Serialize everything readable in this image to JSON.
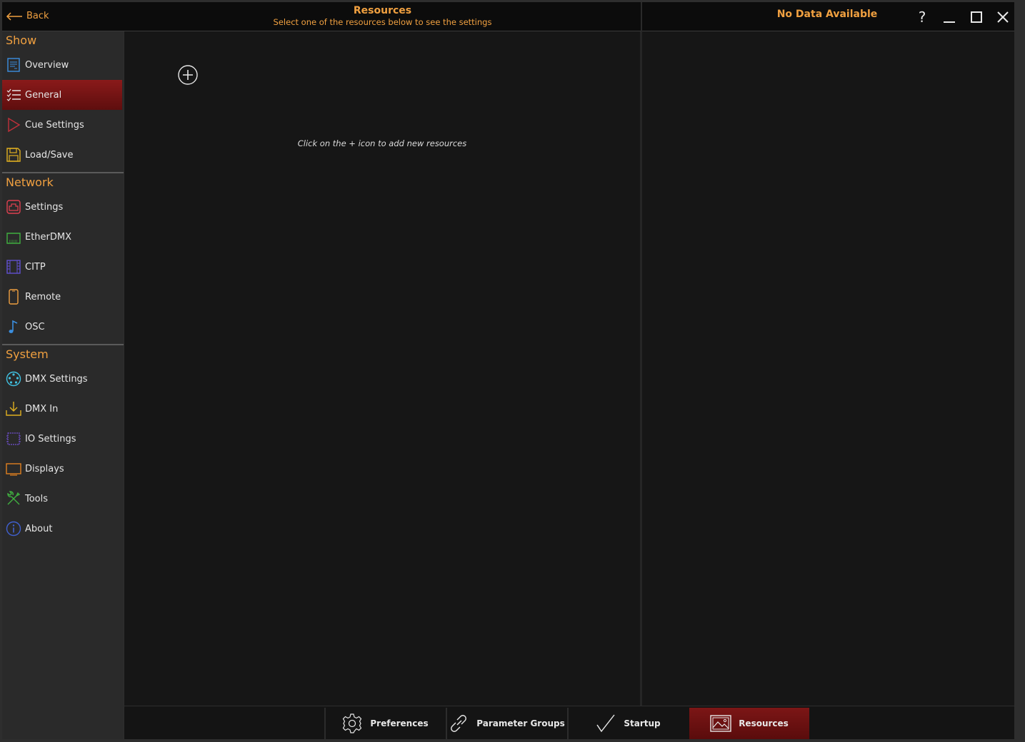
{
  "header": {
    "back_label": "Back",
    "title": "Resources",
    "subtitle": "Select one of the resources below to see the settings",
    "right_title": "No Data Available",
    "help_label": "?"
  },
  "sidebar": {
    "sections": [
      {
        "title": "Show",
        "items": [
          {
            "label": "Overview",
            "icon": "document-icon",
            "color": "#3b8fe0"
          },
          {
            "label": "General",
            "icon": "checklist-icon",
            "color": "#e6e6e6",
            "active": true
          },
          {
            "label": "Cue Settings",
            "icon": "play-icon",
            "color": "#c0303a"
          },
          {
            "label": "Load/Save",
            "icon": "floppy-icon",
            "color": "#e0b020"
          }
        ]
      },
      {
        "title": "Network",
        "items": [
          {
            "label": "Settings",
            "icon": "network-port-icon",
            "color": "#e04050"
          },
          {
            "label": "EtherDMX",
            "icon": "ethernet-icon",
            "color": "#40b040"
          },
          {
            "label": "CITP",
            "icon": "film-icon",
            "color": "#6050d0"
          },
          {
            "label": "Remote",
            "icon": "phone-icon",
            "color": "#f0a040"
          },
          {
            "label": "OSC",
            "icon": "music-note-icon",
            "color": "#3b8fe0"
          }
        ]
      },
      {
        "title": "System",
        "items": [
          {
            "label": "DMX Settings",
            "icon": "dmx-connector-icon",
            "color": "#40c0e0"
          },
          {
            "label": "DMX In",
            "icon": "download-icon",
            "color": "#e0b020"
          },
          {
            "label": "IO Settings",
            "icon": "chip-icon",
            "color": "#7050d0"
          },
          {
            "label": "Displays",
            "icon": "monitor-icon",
            "color": "#e08020"
          },
          {
            "label": "Tools",
            "icon": "tools-icon",
            "color": "#40b040"
          },
          {
            "label": "About",
            "icon": "info-icon",
            "color": "#4060d0"
          }
        ]
      }
    ]
  },
  "main": {
    "hint": "Click on the + icon to add new resources"
  },
  "tabs": [
    {
      "label": "Preferences",
      "icon": "gear-icon"
    },
    {
      "label": "Parameter Groups",
      "icon": "link-icon"
    },
    {
      "label": "Startup",
      "icon": "check-icon"
    },
    {
      "label": "Resources",
      "icon": "image-icon",
      "active": true
    }
  ],
  "colors": {
    "accent": "#f0a040",
    "active": "#7c1616"
  }
}
